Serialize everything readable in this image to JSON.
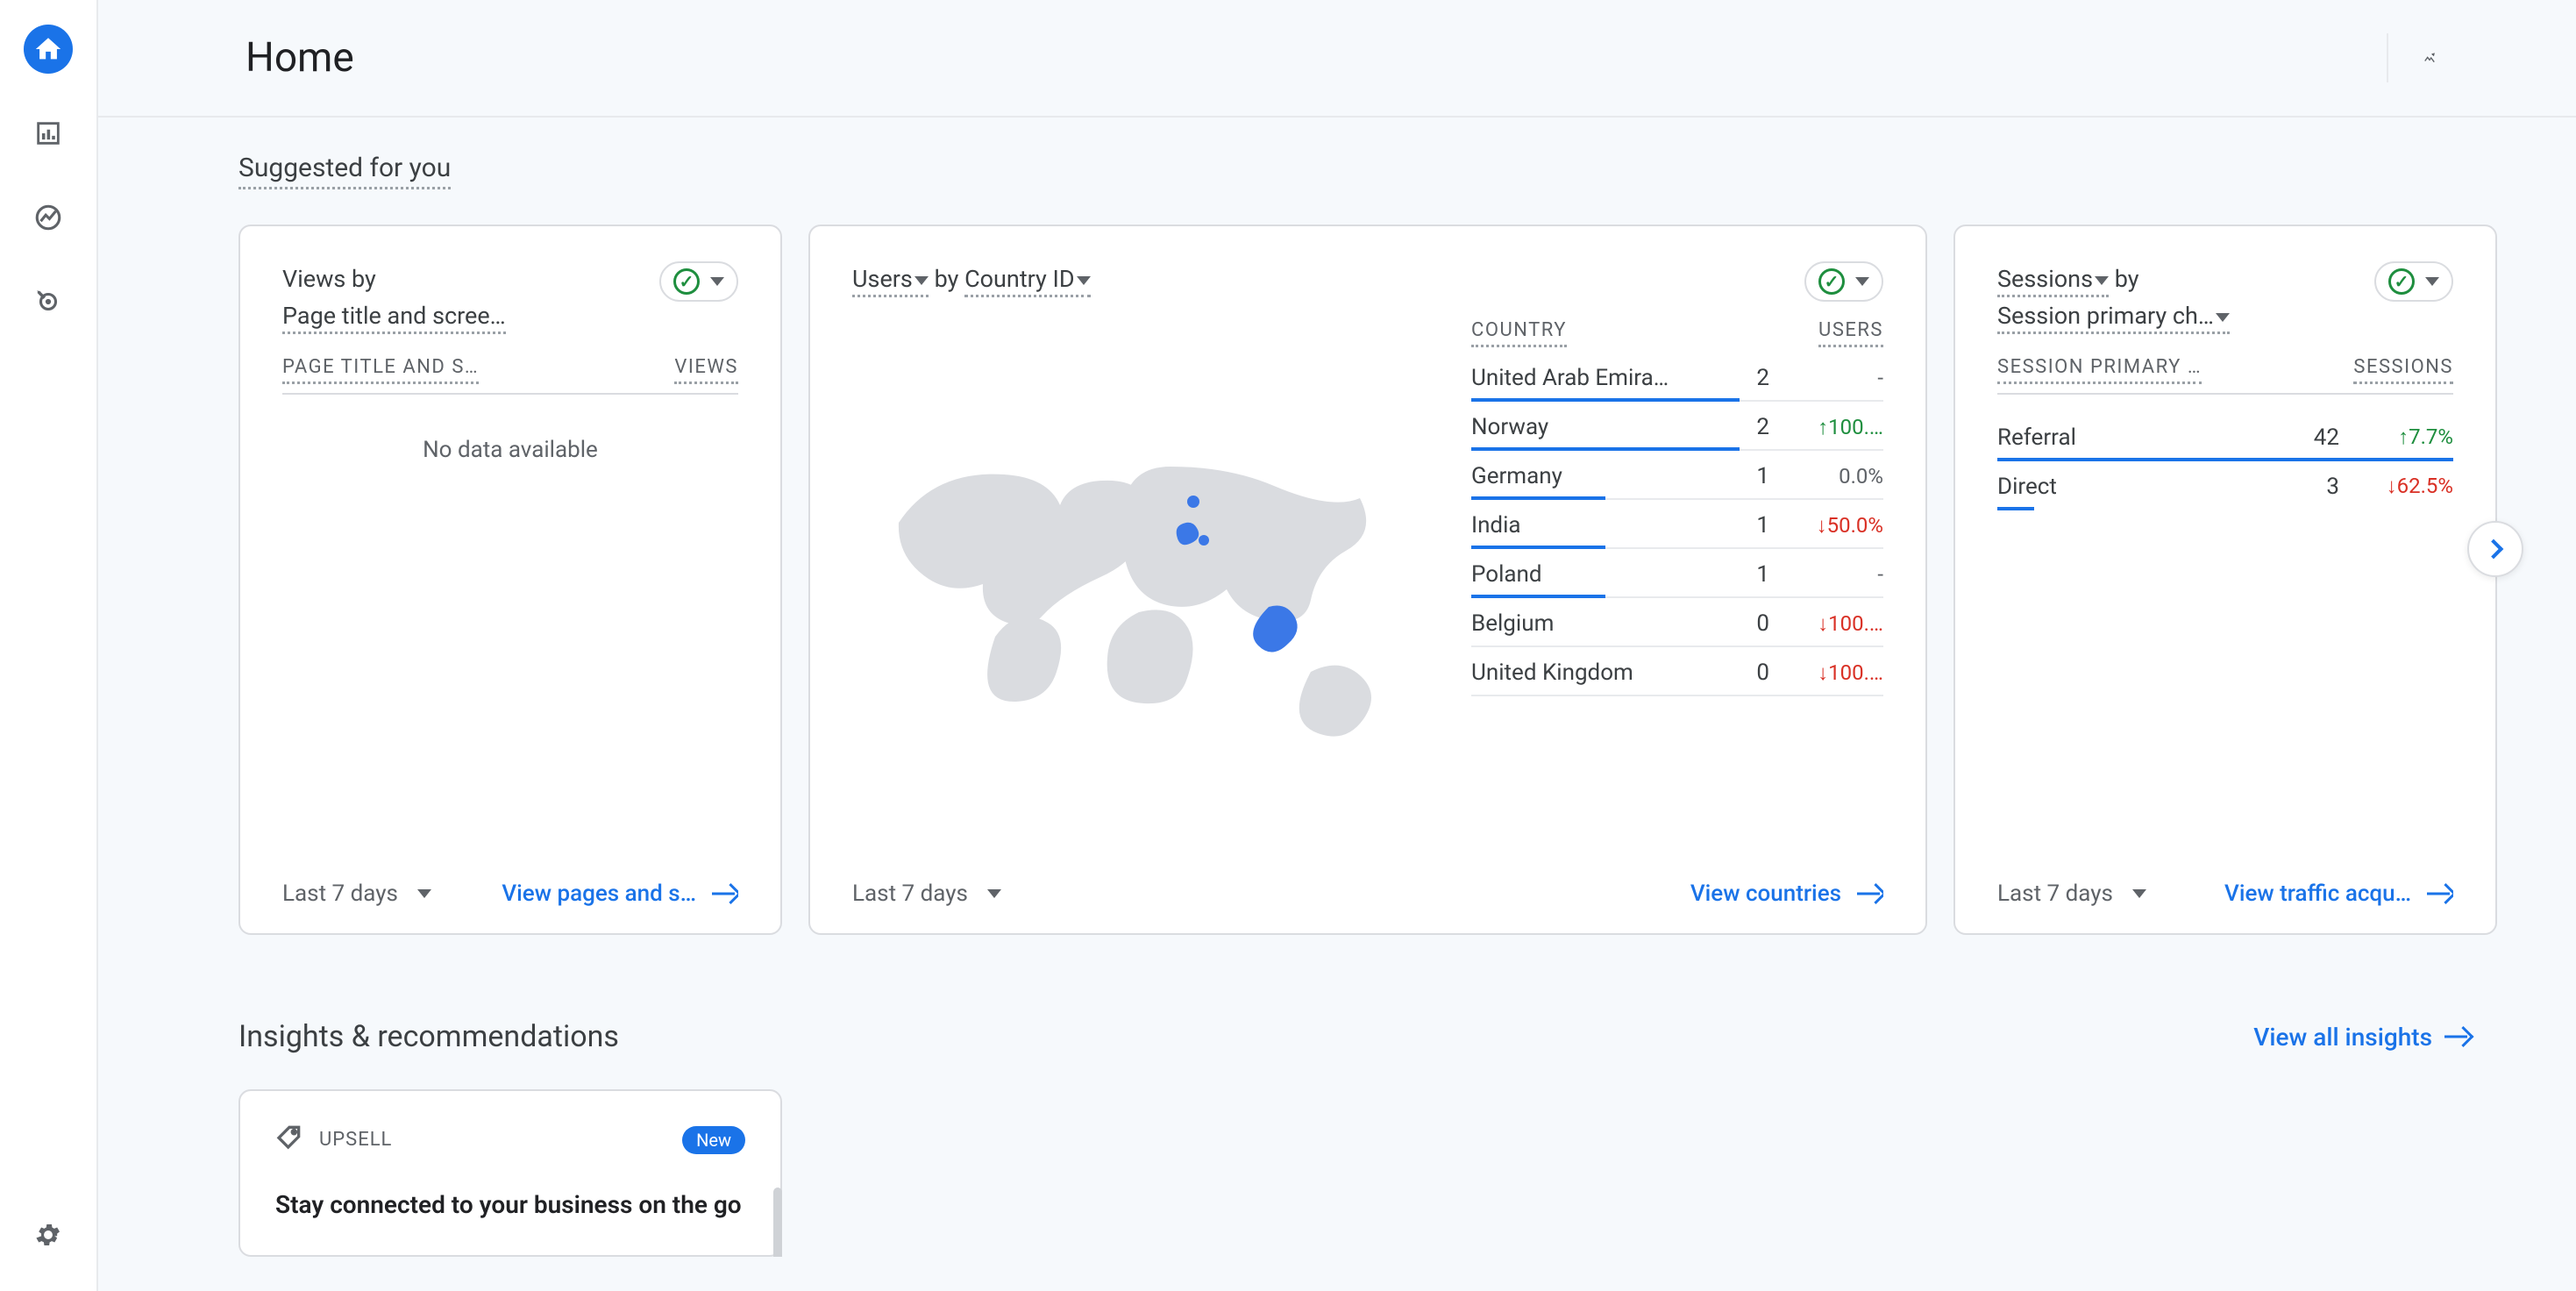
{
  "header": {
    "title": "Home"
  },
  "sections": {
    "suggested": "Suggested for you",
    "insights": "Insights & recommendations",
    "view_all": "View all insights"
  },
  "card_views": {
    "title_a": "Views by",
    "title_b": "Page title and scree…",
    "col_left": "PAGE TITLE AND S…",
    "col_right": "VIEWS",
    "no_data": "No data available",
    "range": "Last 7 days",
    "link": "View pages and s…"
  },
  "card_country": {
    "title_a": "Users",
    "title_b": "by",
    "title_c": "Country ID",
    "col_left": "COUNTRY",
    "col_right": "USERS",
    "range": "Last 7 days",
    "link": "View countries",
    "rows": [
      {
        "name": "United Arab Emira…",
        "value": 2,
        "delta": "-",
        "dir": "flat",
        "bar": 100
      },
      {
        "name": "Norway",
        "value": 2,
        "delta": "100.…",
        "dir": "up",
        "bar": 100
      },
      {
        "name": "Germany",
        "value": 1,
        "delta": "0.0%",
        "dir": "flat",
        "bar": 50
      },
      {
        "name": "India",
        "value": 1,
        "delta": "50.0%",
        "dir": "down",
        "bar": 50
      },
      {
        "name": "Poland",
        "value": 1,
        "delta": "-",
        "dir": "flat",
        "bar": 50
      },
      {
        "name": "Belgium",
        "value": 0,
        "delta": "100.…",
        "dir": "down",
        "bar": 0
      },
      {
        "name": "United Kingdom",
        "value": 0,
        "delta": "100.…",
        "dir": "down",
        "bar": 0
      }
    ]
  },
  "card_sessions": {
    "title_a": "Sessions",
    "title_b": "by",
    "title_c": "Session primary ch…",
    "col_left": "SESSION PRIMARY …",
    "col_right": "SESSIONS",
    "range": "Last 7 days",
    "link": "View traffic acqu…",
    "rows": [
      {
        "name": "Referral",
        "value": 42,
        "delta": "7.7%",
        "dir": "up",
        "bar": 100
      },
      {
        "name": "Direct",
        "value": 3,
        "delta": "62.5%",
        "dir": "down",
        "bar": 8
      }
    ]
  },
  "upsell": {
    "label": "UPSELL",
    "badge": "New",
    "text": "Stay connected to your business on the go"
  }
}
